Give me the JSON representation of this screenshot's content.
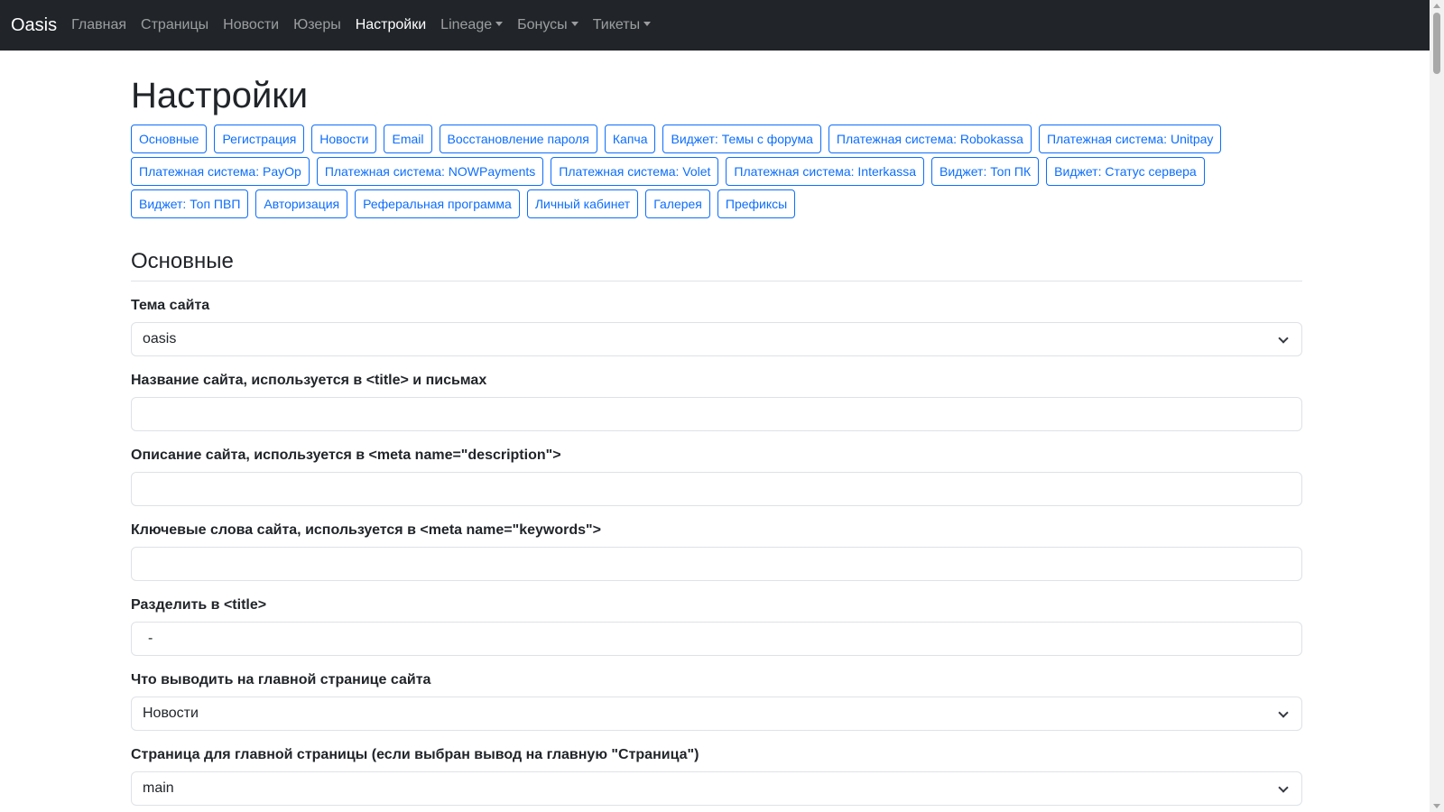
{
  "navbar": {
    "brand": "Oasis",
    "items": [
      {
        "label": "Главная",
        "active": false
      },
      {
        "label": "Страницы",
        "active": false
      },
      {
        "label": "Новости",
        "active": false
      },
      {
        "label": "Юзеры",
        "active": false
      },
      {
        "label": "Настройки",
        "active": true
      },
      {
        "label": "Lineage",
        "dropdown": true
      },
      {
        "label": "Бонусы",
        "dropdown": true
      },
      {
        "label": "Тикеты",
        "dropdown": true
      }
    ]
  },
  "page": {
    "title": "Настройки",
    "tabs": [
      "Основные",
      "Регистрация",
      "Новости",
      "Email",
      "Восстановление пароля",
      "Капча",
      "Виджет: Темы с форума",
      "Платежная система: Robokassa",
      "Платежная система: Unitpay",
      "Платежная система: PayOp",
      "Платежная система: NOWPayments",
      "Платежная система: Volet",
      "Платежная система: Interkassa",
      "Виджет: Топ ПК",
      "Виджет: Статус сервера",
      "Виджет: Топ ПВП",
      "Авторизация",
      "Реферальная программа",
      "Личный кабинет",
      "Галерея",
      "Префиксы"
    ],
    "section_title": "Основные",
    "fields": {
      "theme": {
        "label": "Тема сайта",
        "value": "oasis"
      },
      "site_name": {
        "label": "Название сайта, используется в <title> и письмах",
        "value": ""
      },
      "description": {
        "label": "Описание сайта, используется в <meta name=\"description\">",
        "value": ""
      },
      "keywords": {
        "label": "Ключевые слова сайта, используется в <meta name=\"keywords\">",
        "value": ""
      },
      "separator": {
        "label": "Разделить в <title>",
        "value": "-"
      },
      "main_output": {
        "label": "Что выводить на главной странице сайта",
        "value": "Новости"
      },
      "main_page": {
        "label": "Страница для главной страницы (если выбран вывод на главную \"Страница\")",
        "value": "main"
      }
    }
  },
  "colors": {
    "navbar_bg": "#212529",
    "accent": "#0d6efd"
  }
}
